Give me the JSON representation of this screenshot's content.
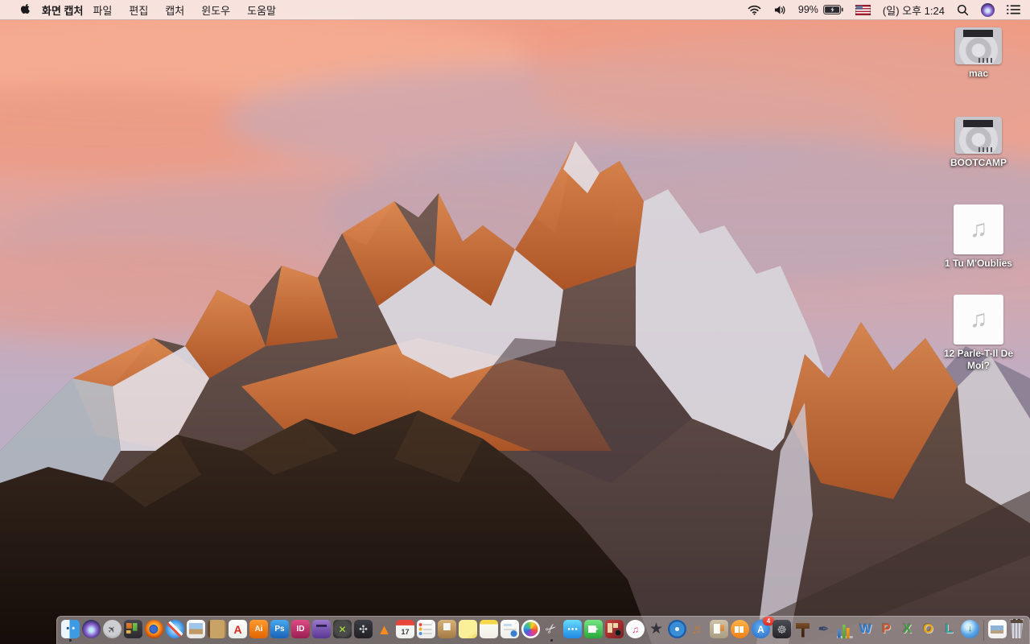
{
  "menu_bar": {
    "app_name": "화면 캡처",
    "menus": [
      "파일",
      "편집",
      "캡처",
      "윈도우",
      "도움말"
    ],
    "status": {
      "battery_percent": "99%",
      "clock": "(일) 오후 1:24"
    },
    "status_colors": {
      "text": "#1c1a1a"
    }
  },
  "desktop": {
    "icons": [
      {
        "name": "drive-mac",
        "type": "drive",
        "label": "mac"
      },
      {
        "name": "drive-bootcamp",
        "type": "drive",
        "label": "BOOTCAMP"
      },
      {
        "name": "audio-file-1",
        "type": "audio",
        "label": "1 Tu M'Oublies",
        "glyph": "♫"
      },
      {
        "name": "audio-file-12",
        "type": "audio",
        "label": "12 Parle-T-Il De Moi?",
        "glyph": "♫"
      }
    ]
  },
  "dock": {
    "apps": [
      {
        "name": "finder",
        "shape": "sq",
        "running": true,
        "bg": "radial-gradient(circle at 36% 45%,#16477e 0 1px,rgba(0,0,0,0) 2px),radial-gradient(circle at 66% 45%,#ffffff 0 1px,rgba(0,0,0,0) 2px),linear-gradient(90deg,#eef6fd 0 46%,#3d9be6 46%)"
      },
      {
        "name": "siri",
        "shape": "circle",
        "bg": "radial-gradient(circle at 50% 55%,#bfe8f7 0 14%,#8a5fd0 42%,#23294e 75%)"
      },
      {
        "name": "launchpad",
        "shape": "circle",
        "bg": "radial-gradient(circle at 50% 40%,#cdced2 0 55%,#8e8f95)",
        "glyph": "✈",
        "fg": "#4c4c52",
        "fs": 12
      },
      {
        "name": "mission-control",
        "shape": "sq",
        "bg": "linear-gradient(#e08030,#c86a1e) 18% 26%/30% 30% no-repeat,linear-gradient(#76c24e,#55a436) 62% 30%/24% 42% no-repeat,linear-gradient(#e8c050,#d8a838) 20% 70%/24% 18% no-repeat,linear-gradient(#45454b,#2a2a30)"
      },
      {
        "name": "firefox",
        "shape": "circle",
        "bg": "radial-gradient(circle at 47% 50%,#3a6cd0 0 22%,#1e4898 32%,rgba(0,0,0,0) 33%),radial-gradient(circle at 50% 44%,#ffd24a 0 10%,#ff9d2e 38%,#e05e00 62%,#a03800 82%)"
      },
      {
        "name": "safari",
        "shape": "circle",
        "bg": "linear-gradient(45deg,rgba(0,0,0,0) 0 41%,#e84c3d 41% 50%,#f8f8f8 50% 59%,rgba(0,0,0,0) 59%),radial-gradient(circle at 50% 50%,#a8ddf8 0 18%,#3f95e8 62%,#1868c8)"
      },
      {
        "name": "preview",
        "shape": "sq",
        "bg": "linear-gradient(180deg,#9fc4e8 0 55%,#bf9a66 55%) 50% 42%/76% 60% no-repeat,linear-gradient(180deg,#fdfdfd,#e6e6e4)"
      },
      {
        "name": "journal-book",
        "shape": "sq",
        "bg": "linear-gradient(90deg,#6a482c 0 14%,#c9a265 14% 92%,#a8824c 92%)"
      },
      {
        "name": "acrobat-reader",
        "shape": "sq",
        "bg": "linear-gradient(180deg,#fdfdfd,#ededeb)",
        "glyph": "A",
        "fg": "#d6281e",
        "fs": 14
      },
      {
        "name": "illustrator",
        "shape": "sq",
        "bg": "linear-gradient(180deg,#ff9a2e,#e06500)",
        "glyph": "Ai",
        "fg": "#ffffff",
        "fs": 10
      },
      {
        "name": "photoshop",
        "shape": "sq",
        "bg": "linear-gradient(180deg,#49a7ef,#1a62b8)",
        "glyph": "Ps",
        "fg": "#ffffff",
        "fs": 10
      },
      {
        "name": "indesign",
        "shape": "sq",
        "bg": "linear-gradient(180deg,#df4a85,#9c1e52)",
        "glyph": "ID",
        "fg": "#ffffff",
        "fs": 10
      },
      {
        "name": "toast-titanium",
        "shape": "sq",
        "bg": "linear-gradient(#2e1e50,#2e1e50) 50% 32%/58% 12% no-repeat,linear-gradient(180deg,#9a78cc,#5a3694)"
      },
      {
        "name": "xbmc",
        "shape": "sq",
        "bg": "radial-gradient(circle at 50% 46%,#4a4a4a 0 56%,#1c1c1c)",
        "glyph": "✕",
        "fg": "#aee838",
        "fs": 12
      },
      {
        "name": "fan-control",
        "shape": "sq",
        "bg": "linear-gradient(180deg,#3c3c44,#202026)",
        "glyph": "✣",
        "fg": "#ccd0d8",
        "fs": 13
      },
      {
        "name": "vlc",
        "shape": "none",
        "glyph": "▲",
        "fg": "#ff8a1e",
        "fs": 18
      },
      {
        "name": "calendar",
        "shape": "sq",
        "bg": "linear-gradient(#e8443a,#e8443a) 0 0/100% 30% no-repeat,linear-gradient(180deg,#fdfdfd,#efefed)",
        "glyph": "17",
        "fg": "#3a3a3a",
        "fs": 9
      },
      {
        "name": "reminders",
        "shape": "sq",
        "bg": "radial-gradient(circle at 20% 26%,#e8443a 0 1.5px,rgba(0,0,0,0) 2.5px),radial-gradient(circle at 20% 50%,#f5a623 0 1.5px,rgba(0,0,0,0) 2.5px),radial-gradient(circle at 20% 74%,#4a90d9 0 1.5px,rgba(0,0,0,0) 2.5px),linear-gradient(#d4d4d4,#d4d4d4) 62% 26%/46% 2px no-repeat,linear-gradient(#d4d4d4,#d4d4d4) 62% 50%/46% 2px no-repeat,linear-gradient(#d4d4d4,#d4d4d4) 62% 74%/46% 2px no-repeat,linear-gradient(180deg,#fefefe,#ececea)"
      },
      {
        "name": "archive-utility",
        "shape": "sq",
        "bg": "linear-gradient(#f4f4f2,#f4f4f2) 50% 30%/38% 40% no-repeat,linear-gradient(180deg,#d8b278,#a47a44)"
      },
      {
        "name": "stickies",
        "shape": "sq",
        "bg": "linear-gradient(145deg,#fbf09a 0 72%,#e6d252)"
      },
      {
        "name": "notes",
        "shape": "sq",
        "bg": "linear-gradient(#f5d94a,#f5d94a) 0 0/100% 24% no-repeat,linear-gradient(180deg,#fffef8,#f0efe6)"
      },
      {
        "name": "document-stamp",
        "shape": "sq",
        "bg": "radial-gradient(circle at 72% 74%,#3a7fd0 0 3.5px,rgba(0,0,0,0) 4.5px),linear-gradient(#bcd8ee,#bcd8ee) 30% 26%/42% 12% no-repeat,linear-gradient(#d8d8d6,#d8d8d6) 50% 50%/68% 2px no-repeat,linear-gradient(180deg,#fdfdfc,#eeeeea)"
      },
      {
        "name": "photos",
        "shape": "circle",
        "bg": "conic-gradient(from 20deg,#f9d423,#f98e2b,#ee4b3e,#d442a0,#8a4bd4,#3b6fd4,#35b0c8,#52c46a,#f9d423)"
      },
      {
        "name": "screen-capture",
        "shape": "none",
        "running": true,
        "glyph": "✂",
        "fg": "#e4e4ea",
        "fs": 16
      },
      {
        "name": "messages",
        "shape": "sq",
        "bg": "linear-gradient(180deg,#67dafc,#1e88e5)",
        "glyph": "⋯",
        "fg": "#ffffff",
        "fs": 13
      },
      {
        "name": "facetime",
        "shape": "sq",
        "bg": "linear-gradient(#ffffff,#ffffff) 34% 50%/42% 40% no-repeat,linear-gradient(180deg,#74e684,#28a838)",
        "glyph": "▸",
        "fg": "#ffffff",
        "fs": 10
      },
      {
        "name": "photo-booth",
        "shape": "sq",
        "bg": "linear-gradient(#ecd8ac,#ecd8ac) 20% 22%/26% 26% no-repeat,linear-gradient(#ecd8ac,#ecd8ac) 56% 22%/26% 26% no-repeat,linear-gradient(#ecd8ac,#ecd8ac) 20% 58%/26% 26% no-repeat,radial-gradient(circle at 70% 70%,#161616 0 3px,#4a4a4a 3.5px,rgba(0,0,0,0) 4.5px),linear-gradient(135deg,#c84040,#7e1c1c)"
      },
      {
        "name": "itunes",
        "shape": "circle",
        "bg": "radial-gradient(circle at 50% 45%,#ffffff 0 64%,#e2e2e8)",
        "glyph": "♫",
        "fg": "#e0457b",
        "fs": 12
      },
      {
        "name": "imovie",
        "shape": "none",
        "glyph": "★",
        "fg": "#34343a",
        "fs": 19
      },
      {
        "name": "dvd-player",
        "shape": "circle",
        "bg": "radial-gradient(circle at 50% 50%,#e8f4fc 0 15%,#3a8ed8 16% 56%,#1a5ca8 57% 72%,#8ab8e0 73%)"
      },
      {
        "name": "garageband",
        "shape": "none",
        "glyph": "♬",
        "fg": "#c07c3c",
        "fs": 17
      },
      {
        "name": "scrapbook",
        "shape": "sq",
        "bg": "linear-gradient(#fbfbf6,#fbfbf6) 30% 48%/34% 54% no-repeat,linear-gradient(#e8a25a,#d0843a) 70% 42%/28% 34% no-repeat,linear-gradient(180deg,#cfc3a8,#aa9c80)"
      },
      {
        "name": "ibooks",
        "shape": "circle",
        "bg": "linear-gradient(#ffffff,#ffffff) 30% 54%/22% 36% no-repeat,linear-gradient(#ffffff,#ffffff) 64% 54%/22% 36% no-repeat,linear-gradient(180deg,#ffb347,#ef7f18)"
      },
      {
        "name": "app-store",
        "shape": "circle",
        "badge": "4",
        "bg": "radial-gradient(circle at 50% 40%,#68b2f2,#1e66c6)",
        "glyph": "A",
        "fg": "#ffffff",
        "fs": 12
      },
      {
        "name": "steering-wheel",
        "shape": "sq",
        "bg": "linear-gradient(180deg,#4c4c54,#24242a)",
        "glyph": "☸",
        "fg": "#b8b8c2",
        "fs": 14
      },
      {
        "name": "keynote",
        "shape": "none",
        "bg": "linear-gradient(#7c4e2c,#5e3a1c) 50% 24%/74% 30% no-repeat,linear-gradient(#4c2e16,#3a2410) 50% 84%/16% 50% no-repeat"
      },
      {
        "name": "pages",
        "shape": "none",
        "glyph": "✒",
        "fg": "#35466b",
        "fs": 17
      },
      {
        "name": "numbers",
        "shape": "none",
        "bg": "linear-gradient(#4a90d9,#2a66b0) 16% 100%/16% 46% no-repeat,linear-gradient(#7ec24a,#4e9a26) 44% 100%/16% 76% no-repeat,linear-gradient(#f5a623,#d0820e) 72% 100%/16% 58% no-repeat,linear-gradient(#bcbcc0,#bcbcc0) 54% 100%/86% 3px no-repeat"
      },
      {
        "name": "word",
        "shape": "none",
        "glyph": "W",
        "fg": "#2b7cd3",
        "fs": 16,
        "letter": true
      },
      {
        "name": "powerpoint",
        "shape": "none",
        "glyph": "P",
        "fg": "#d4532a",
        "fs": 16,
        "letter": true
      },
      {
        "name": "excel",
        "shape": "none",
        "glyph": "X",
        "fg": "#3f9e3f",
        "fs": 16,
        "letter": true
      },
      {
        "name": "outlook",
        "shape": "none",
        "glyph": "O",
        "fg": "#eea500",
        "fs": 16,
        "letter": true
      },
      {
        "name": "lync",
        "shape": "none",
        "glyph": "L",
        "fg": "#2aa8a0",
        "fs": 16,
        "letter": true
      },
      {
        "name": "ms-autoupdate",
        "shape": "circle",
        "bg": "radial-gradient(circle at 40% 35%,#d8f0fc 0 16%,#57a6e8 52%,#2a6cc0)",
        "glyph": "↓",
        "fg": "#2e8a2e",
        "fs": 11
      }
    ],
    "files": [
      {
        "name": "image-document",
        "shape": "sq",
        "bg": "linear-gradient(180deg,#8cb2d8 0 58%,#b8a080 58%) 50% 52%/70% 44% no-repeat,linear-gradient(180deg,#fdfdfd,#f0f0ee)"
      }
    ],
    "trash": {
      "name": "trash",
      "shape": "none",
      "state": "full"
    }
  }
}
